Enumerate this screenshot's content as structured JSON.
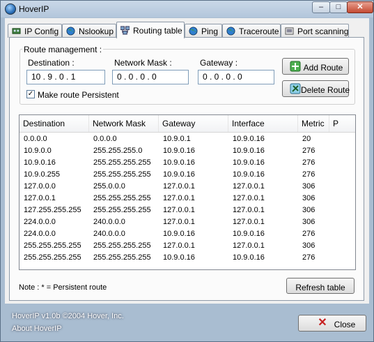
{
  "window": {
    "title": "HoverIP"
  },
  "tabs": [
    {
      "label": "IP Config",
      "icon": "network-card-icon"
    },
    {
      "label": "Nslookup",
      "icon": "globe-icon"
    },
    {
      "label": "Routing table",
      "icon": "network-computers-icon",
      "active": true
    },
    {
      "label": "Ping",
      "icon": "globe-icon"
    },
    {
      "label": "Traceroute",
      "icon": "globe-icon"
    },
    {
      "label": "Port scanning",
      "icon": "port-icon"
    }
  ],
  "route": {
    "group_title": "Route management :",
    "destination_label": "Destination :",
    "mask_label": "Network Mask :",
    "gateway_label": "Gateway :",
    "destination_value": "10 . 9 . 0 . 1",
    "mask_value": "0 . 0 . 0 . 0",
    "gateway_value": "0 . 0 . 0 . 0",
    "persistent_label": "Make route Persistent",
    "persistent_checked": true,
    "add_label": "Add Route",
    "delete_label": "Delete Route"
  },
  "table": {
    "columns": [
      "Destination",
      "Network Mask",
      "Gateway",
      "Interface",
      "Metric",
      "P"
    ],
    "rows": [
      [
        "0.0.0.0",
        "0.0.0.0",
        "10.9.0.1",
        "10.9.0.16",
        "20"
      ],
      [
        "10.9.0.0",
        "255.255.255.0",
        "10.9.0.16",
        "10.9.0.16",
        "276"
      ],
      [
        "10.9.0.16",
        "255.255.255.255",
        "10.9.0.16",
        "10.9.0.16",
        "276"
      ],
      [
        "10.9.0.255",
        "255.255.255.255",
        "10.9.0.16",
        "10.9.0.16",
        "276"
      ],
      [
        "127.0.0.0",
        "255.0.0.0",
        "127.0.0.1",
        "127.0.0.1",
        "306"
      ],
      [
        "127.0.0.1",
        "255.255.255.255",
        "127.0.0.1",
        "127.0.0.1",
        "306"
      ],
      [
        "127.255.255.255",
        "255.255.255.255",
        "127.0.0.1",
        "127.0.0.1",
        "306"
      ],
      [
        "224.0.0.0",
        "240.0.0.0",
        "127.0.0.1",
        "127.0.0.1",
        "306"
      ],
      [
        "224.0.0.0",
        "240.0.0.0",
        "10.9.0.16",
        "10.9.0.16",
        "276"
      ],
      [
        "255.255.255.255",
        "255.255.255.255",
        "127.0.0.1",
        "127.0.0.1",
        "306"
      ],
      [
        "255.255.255.255",
        "255.255.255.255",
        "10.9.0.16",
        "10.9.0.16",
        "276"
      ]
    ]
  },
  "note": "Note : * = Persistent route",
  "refresh_label": "Refresh table",
  "footer": {
    "copyright": "HoverIP v1.0b ©2004 Hover, Inc.",
    "about": "About HoverIP",
    "close_label": "Close"
  }
}
